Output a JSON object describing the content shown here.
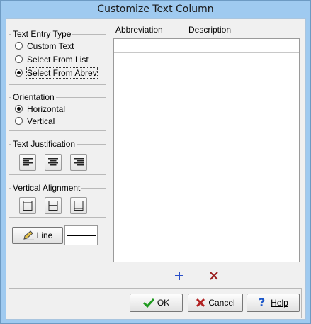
{
  "window": {
    "title": "Customize Text Column"
  },
  "text_entry_type": {
    "legend": "Text Entry Type",
    "options": [
      "Custom Text",
      "Select From List",
      "Select From Abrev"
    ],
    "selected": "Select From Abrev"
  },
  "orientation": {
    "legend": "Orientation",
    "options": [
      "Horizontal",
      "Vertical"
    ],
    "selected": "Horizontal"
  },
  "text_justification": {
    "legend": "Text Justification",
    "buttons": [
      "align-left-icon",
      "align-center-icon",
      "align-right-icon"
    ]
  },
  "vertical_alignment": {
    "legend": "Vertical Alignment",
    "buttons": [
      "align-top-icon",
      "align-middle-icon",
      "align-bottom-icon"
    ]
  },
  "line": {
    "label": "Line"
  },
  "table": {
    "columns": [
      "Abbreviation",
      "Description"
    ],
    "rows": [
      [
        "",
        ""
      ]
    ]
  },
  "footer": {
    "ok": "OK",
    "cancel": "Cancel",
    "help": "Help"
  },
  "colors": {
    "titlebar": "#9fcaf0",
    "add_icon": "#2a4fc9",
    "delete_icon": "#9a1b1b",
    "ok_check": "#1e9a1e",
    "cancel_x": "#b22222"
  }
}
